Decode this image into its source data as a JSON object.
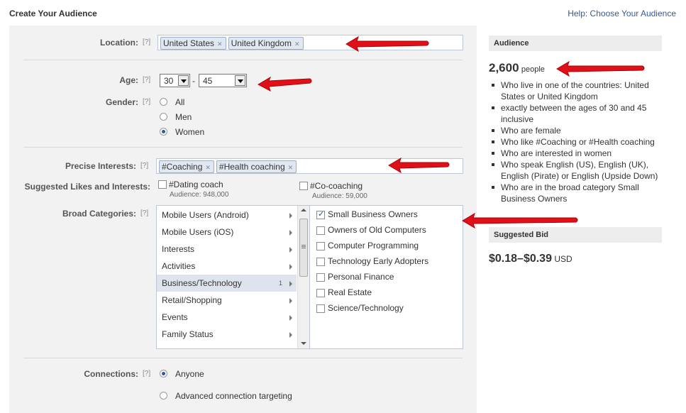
{
  "header": {
    "title": "Create Your Audience",
    "help_link": "Help: Choose Your Audience"
  },
  "help_marker": "[?]",
  "location": {
    "label": "Location:",
    "tokens": [
      "United States",
      "United Kingdom"
    ]
  },
  "age": {
    "label": "Age:",
    "min": "30",
    "separator": "-",
    "max": "45"
  },
  "gender": {
    "label": "Gender:",
    "options": [
      "All",
      "Men",
      "Women"
    ],
    "selected": "Women"
  },
  "precise_interests": {
    "label": "Precise Interests:",
    "tokens": [
      "#Coaching",
      "#Health coaching"
    ]
  },
  "suggested": {
    "label": "Suggested Likes and Interests:",
    "items": [
      {
        "name": "#Dating coach",
        "audience": "Audience: 948,000"
      },
      {
        "name": "#Co-coaching",
        "audience": "Audience: 59,000"
      }
    ]
  },
  "broad_categories": {
    "label": "Broad Categories:",
    "categories": [
      {
        "label": "Mobile Users (Android)"
      },
      {
        "label": "Mobile Users (iOS)"
      },
      {
        "label": "Interests"
      },
      {
        "label": "Activities"
      },
      {
        "label": "Business/Technology",
        "count": "1",
        "selected": true
      },
      {
        "label": "Retail/Shopping"
      },
      {
        "label": "Events"
      },
      {
        "label": "Family Status"
      }
    ],
    "subcategories": [
      {
        "label": "Small Business Owners",
        "checked": true
      },
      {
        "label": "Owners of Old Computers",
        "checked": false
      },
      {
        "label": "Computer Programming",
        "checked": false
      },
      {
        "label": "Technology Early Adopters",
        "checked": false
      },
      {
        "label": "Personal Finance",
        "checked": false
      },
      {
        "label": "Real Estate",
        "checked": false
      },
      {
        "label": "Science/Technology",
        "checked": false
      }
    ]
  },
  "connections": {
    "label": "Connections:",
    "options": [
      "Anyone",
      "Advanced connection targeting"
    ],
    "selected": "Anyone"
  },
  "audience": {
    "heading": "Audience",
    "count": "2,600",
    "unit": "people",
    "bullets": [
      "Who live in one of the countries: United States or United Kingdom",
      "exactly between the ages of 30 and 45 inclusive",
      "Who are female",
      "Who like #Coaching or #Health coaching",
      "Who are interested in women",
      "Who speak English (US), English (UK), English (Pirate) or English (Upside Down)",
      "Who are in the broad category Small Business Owners"
    ]
  },
  "suggested_bid": {
    "heading": "Suggested Bid",
    "range": "$0.18–$0.39",
    "currency": "USD"
  },
  "colors": {
    "link": "#3b5998",
    "panel_bg": "#f2f2f2",
    "token_bg": "#e2e8f0",
    "arrow": "#e0101a"
  },
  "icons": [
    "token-remove-icon",
    "dropdown-arrow-icon",
    "chevron-right-icon",
    "checkmark-icon",
    "radio-icon",
    "red-arrow-icon"
  ]
}
